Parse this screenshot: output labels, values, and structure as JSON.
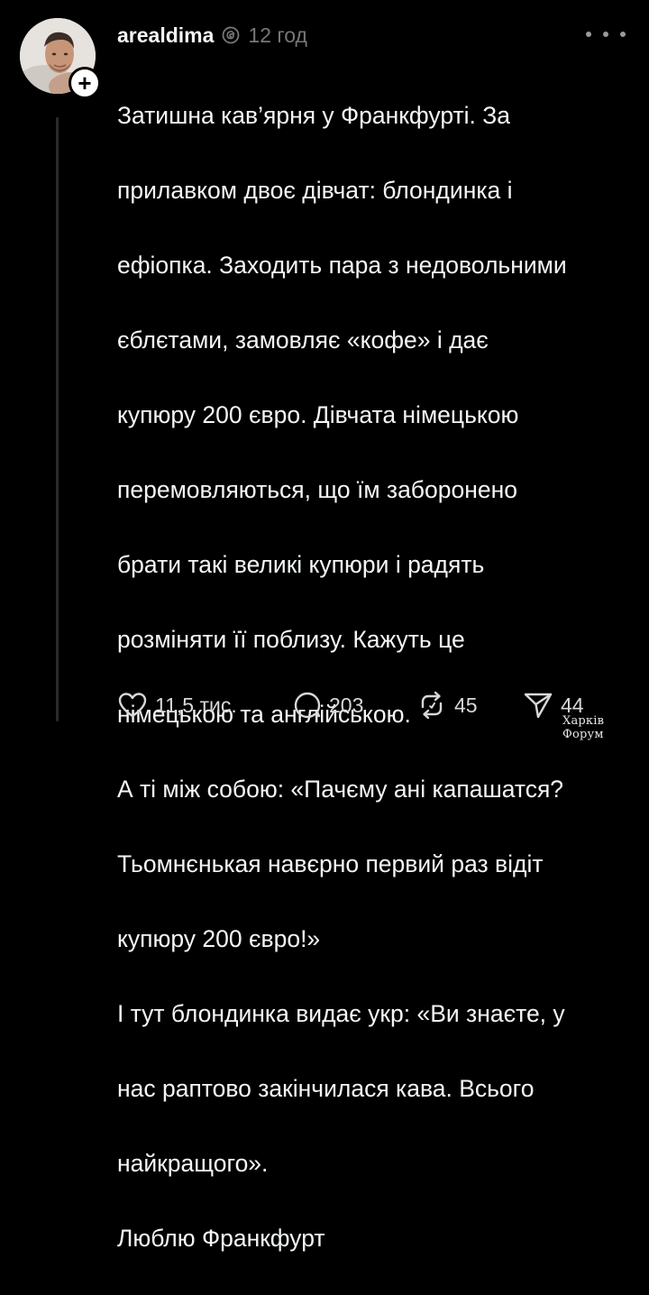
{
  "post": {
    "username": "arealdima",
    "timestamp": "12 год",
    "icons": {
      "verified": "threads-ai-badge-icon",
      "more": "more-dots-icon",
      "follow": "plus-icon"
    },
    "text_lines": [
      "Затишна кав’ярня у Франкфурті. За",
      "прилавком двоє дівчат: блондинка і",
      "ефіопка. Заходить пара з недовольними",
      "єблєтами, замовляє «кофе» і дає",
      "купюру 200 євро. Дівчата німецькою",
      "перемовляються, що їм заборонено",
      "брати такі великі купюри і радять",
      "розміняти її поблизу. Кажуть це",
      "німецькою та англійською.",
      "А ті між собою: «Пачєму ані капашатся?",
      "Тьомнєнькая навєрно первий раз відіт",
      "купюру 200 євро!»",
      "І тут блондинка видає укр: «Ви знаєте, у",
      "нас раптово закінчилася кава. Всього",
      "найкращого».",
      "Люблю Франкфурт"
    ],
    "actions": {
      "likes": "11,5 тис.",
      "replies": "203",
      "reposts": "45",
      "shares": "44"
    }
  },
  "watermark": "Харків Форум",
  "colors": {
    "background": "#000000",
    "text": "#f3f5f7",
    "muted": "#777777",
    "thread_line": "#2b2b2b"
  }
}
